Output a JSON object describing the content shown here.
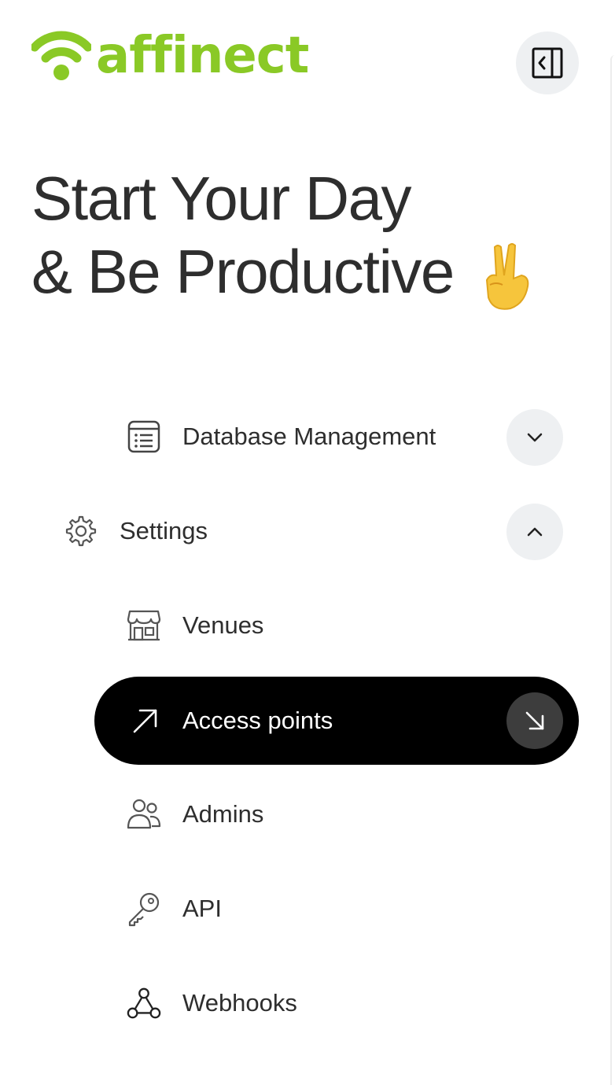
{
  "brand": {
    "name": "affinect",
    "color": "#8ac926"
  },
  "header": {
    "collapse_icon": "sidebar-collapse-icon"
  },
  "headline": {
    "line1": "Start Your Day",
    "line2": "& Be Productive",
    "emoji": "victory-hand"
  },
  "nav": {
    "database": {
      "label": "Database Management",
      "icon": "list-icon",
      "expanded": false
    },
    "settings": {
      "label": "Settings",
      "icon": "gear-icon",
      "expanded": true,
      "items": [
        {
          "label": "Venues",
          "icon": "storefront-icon",
          "active": false
        },
        {
          "label": "Access points",
          "icon": "arrow-up-right-icon",
          "active": true
        },
        {
          "label": "Admins",
          "icon": "users-icon",
          "active": false
        },
        {
          "label": "API",
          "icon": "key-icon",
          "active": false
        },
        {
          "label": "Webhooks",
          "icon": "webhook-icon",
          "active": false
        }
      ]
    }
  },
  "colors": {
    "active_bg": "#000000",
    "chip_bg": "#eef0f2",
    "text": "#2e2e2e"
  }
}
